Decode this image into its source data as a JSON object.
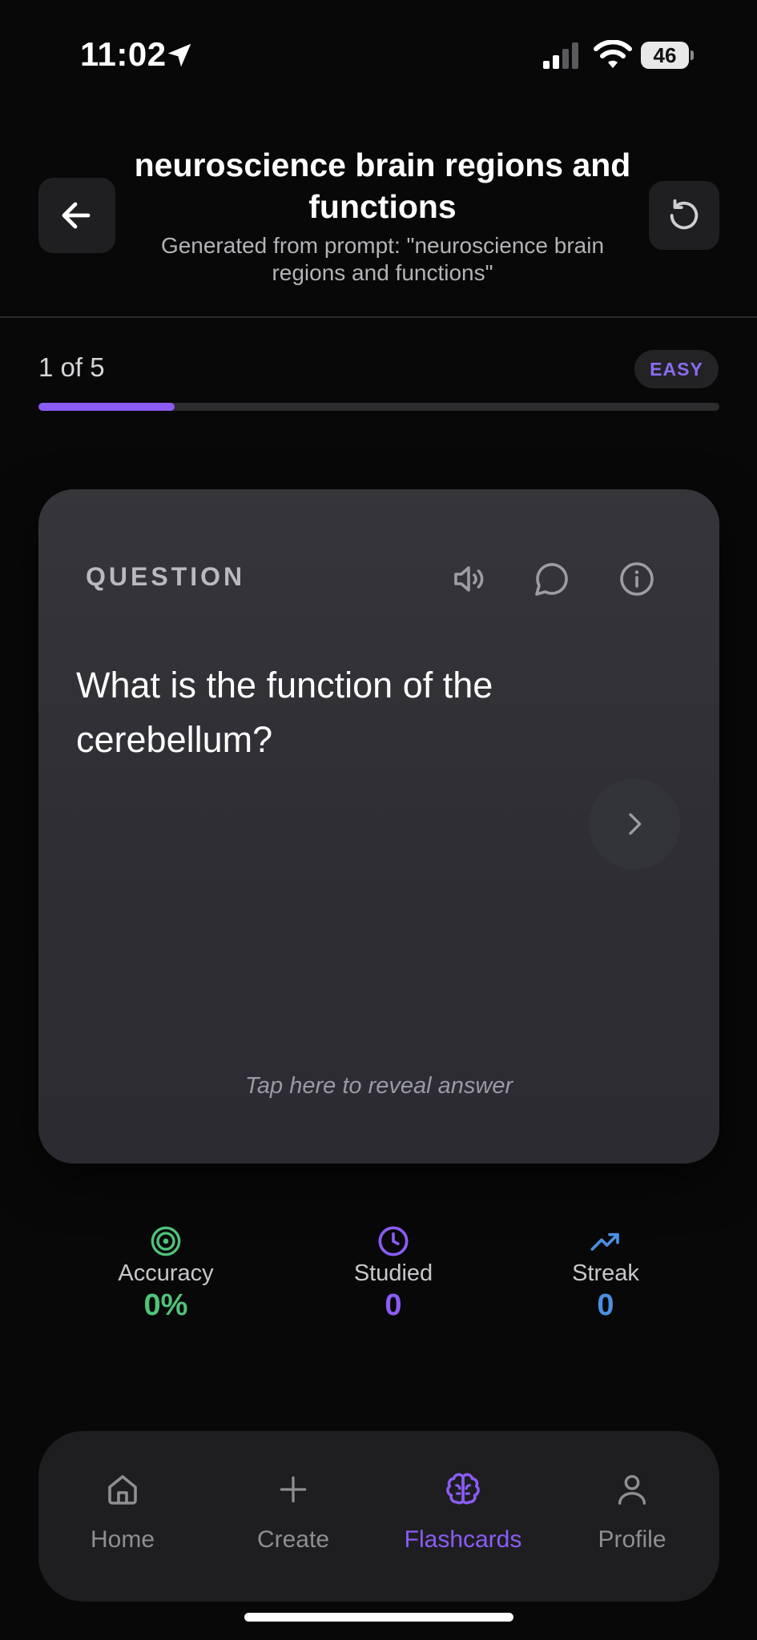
{
  "status_bar": {
    "time": "11:02",
    "battery": "46"
  },
  "header": {
    "title": "neuroscience brain regions and functions",
    "subtitle": "Generated from prompt: \"neuroscience brain regions and functions\"",
    "back_icon": "arrow-left-icon",
    "reset_icon": "reset-icon"
  },
  "progress": {
    "label": "1 of 5",
    "current": 1,
    "total": 5,
    "fraction": 0.2,
    "difficulty": "EASY"
  },
  "card": {
    "label": "QUESTION",
    "question": "What is the function of the cerebellum?",
    "reveal_hint": "Tap here to reveal answer",
    "icons": [
      "speaker-icon",
      "comment-icon",
      "info-icon"
    ]
  },
  "stats": {
    "accuracy": {
      "label": "Accuracy",
      "value": "0%",
      "color": "#4fc37a"
    },
    "studied": {
      "label": "Studied",
      "value": "0",
      "color": "#8b5cf6"
    },
    "streak": {
      "label": "Streak",
      "value": "0",
      "color": "#4a90e2"
    }
  },
  "nav": {
    "items": [
      {
        "label": "Home",
        "icon": "home-icon",
        "active": false
      },
      {
        "label": "Create",
        "icon": "plus-icon",
        "active": false
      },
      {
        "label": "Flashcards",
        "icon": "brain-icon",
        "active": true
      },
      {
        "label": "Profile",
        "icon": "person-icon",
        "active": false
      }
    ]
  },
  "colors": {
    "accent": "#8b5cf6",
    "background": "#080808",
    "card": "#323238"
  }
}
